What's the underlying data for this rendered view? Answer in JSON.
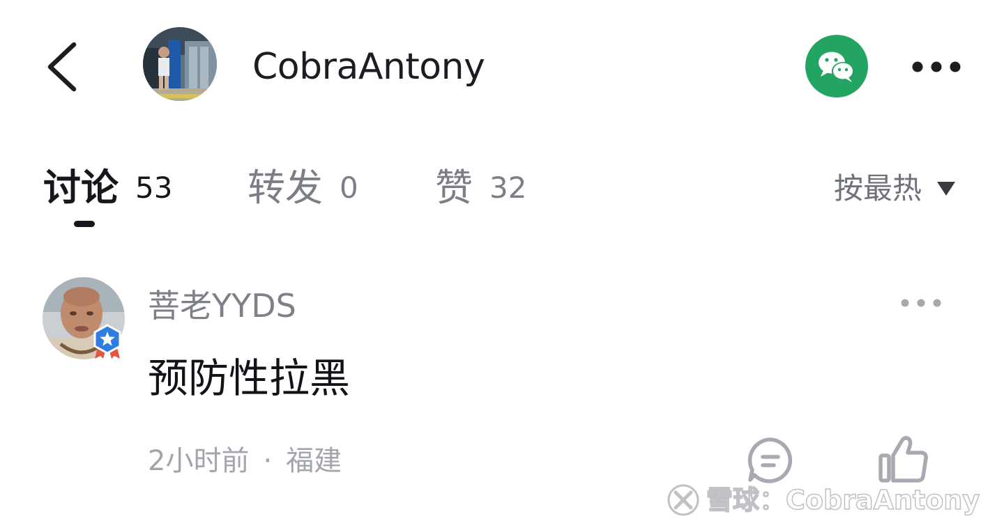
{
  "header": {
    "username": "CobraAntony",
    "back_icon": "chevron-left-icon",
    "share_icon": "wechat-icon",
    "more_icon": "more-horizontal-icon",
    "accent_color": "#23a462"
  },
  "tabs": [
    {
      "label": "讨论",
      "count": "53",
      "active": true
    },
    {
      "label": "转发",
      "count": "0",
      "active": false
    },
    {
      "label": "赞",
      "count": "32",
      "active": false
    }
  ],
  "sort": {
    "label": "按最热",
    "icon": "caret-down-icon"
  },
  "comments": [
    {
      "author": "菩老YYDS",
      "text": "预防性拉黑",
      "time": "2小时前",
      "separator": "·",
      "location": "福建",
      "badge_icon": "verified-star-icon",
      "reply_icon": "comment-icon",
      "like_icon": "thumbs-up-icon",
      "more_icon": "more-horizontal-icon"
    }
  ],
  "watermark": {
    "text": "雪球：CobraAntony"
  }
}
